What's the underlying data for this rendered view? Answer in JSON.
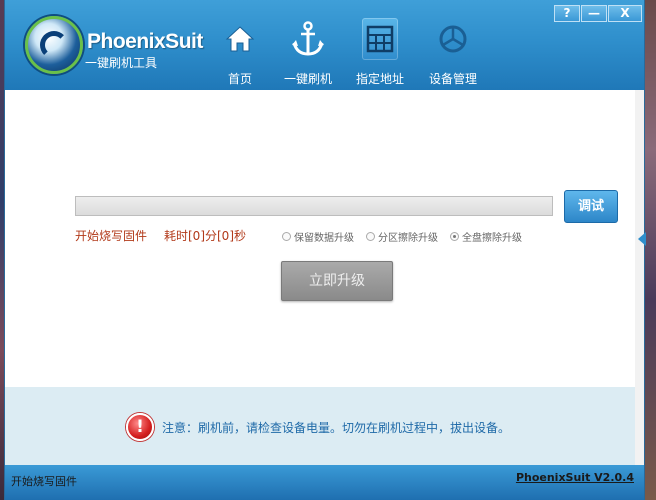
{
  "app": {
    "title": "PhoenixSuit",
    "subtitle": "一键刷机工具",
    "version": "PhoenixSuit V2.0.4"
  },
  "window_controls": {
    "help": "?",
    "minimize": "—",
    "close": "X"
  },
  "nav": {
    "items": [
      {
        "label": "首页",
        "icon": "home-icon"
      },
      {
        "label": "一键刷机",
        "icon": "anchor-icon"
      },
      {
        "label": "指定地址",
        "icon": "grid-icon"
      },
      {
        "label": "设备管理",
        "icon": "device-icon"
      }
    ],
    "active_index": 2
  },
  "flash": {
    "progress": 0,
    "debug_label": "调试",
    "status_text": "开始烧写固件",
    "elapsed_text": "耗时[0]分[0]秒",
    "options": [
      {
        "label": "保留数据升级",
        "checked": false
      },
      {
        "label": "分区擦除升级",
        "checked": false
      },
      {
        "label": "全盘擦除升级",
        "checked": true
      }
    ],
    "upgrade_label": "立即升级"
  },
  "notice": {
    "icon": "exclamation-icon",
    "text": "注意：刷机前，请检查设备电量。切勿在刷机过程中，拔出设备。"
  },
  "statusbar": {
    "left": "开始烧写固件"
  },
  "colors": {
    "header": "#2f8fcc",
    "accent_red": "#b23a1a",
    "notice_bg": "#dcecf3",
    "notice_text": "#1f6aa8"
  }
}
